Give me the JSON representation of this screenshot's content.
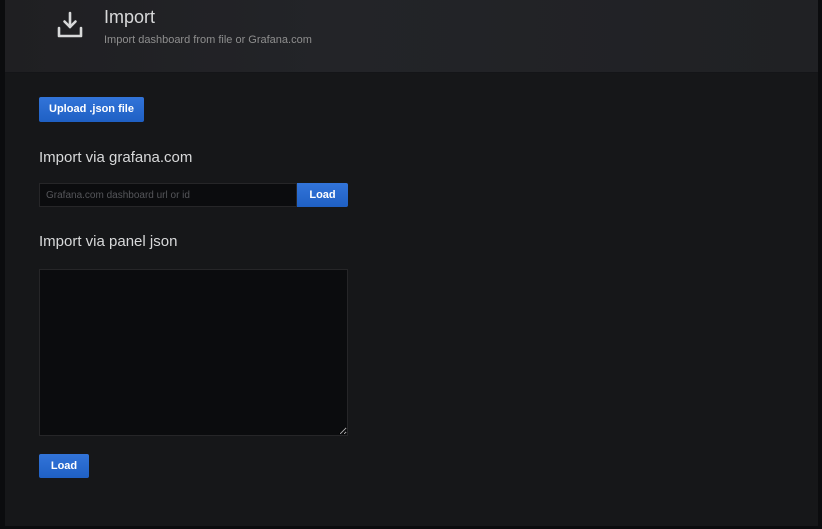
{
  "header": {
    "icon": "download-icon",
    "title": "Import",
    "subtitle": "Import dashboard from file or Grafana.com"
  },
  "upload": {
    "label": "Upload .json file"
  },
  "grafana_com": {
    "title": "Import via grafana.com",
    "input_placeholder": "Grafana.com dashboard url or id",
    "input_value": "",
    "load_label": "Load"
  },
  "panel_json": {
    "title": "Import via panel json",
    "textarea_value": "",
    "load_label": "Load"
  },
  "colors": {
    "background": "#161719",
    "header_background": "#212124",
    "primary_button": "#1f60c4",
    "input_background": "#0b0c0e"
  }
}
